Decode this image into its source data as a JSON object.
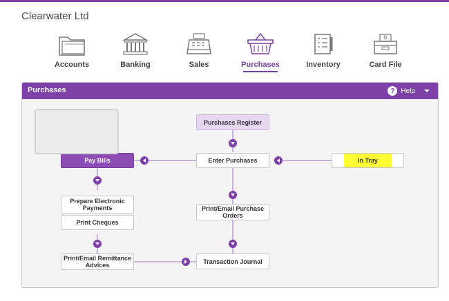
{
  "company": "Clearwater Ltd",
  "nav": {
    "accounts": "Accounts",
    "banking": "Banking",
    "sales": "Sales",
    "purchases": "Purchases",
    "inventory": "Inventory",
    "card_file": "Card File",
    "active": "Purchases"
  },
  "panel": {
    "title": "Purchases",
    "help_label": "Help",
    "help_symbol": "?"
  },
  "flow": {
    "purchases_register": "Purchases Register",
    "pay_bills": "Pay Bills",
    "enter_purchases": "Enter Purchases",
    "in_tray": "In Tray",
    "prepare_electronic_payments": "Prepare Electronic Payments",
    "print_cheques": "Print Cheques",
    "print_email_purchase_orders": "Print/Email Purchase Orders",
    "print_email_remittance_advices": "Print/Email Remittance Advices",
    "transaction_journal": "Transaction Journal"
  },
  "colors": {
    "brand_purple": "#7d3fa8",
    "highlight": "#ffff33"
  }
}
